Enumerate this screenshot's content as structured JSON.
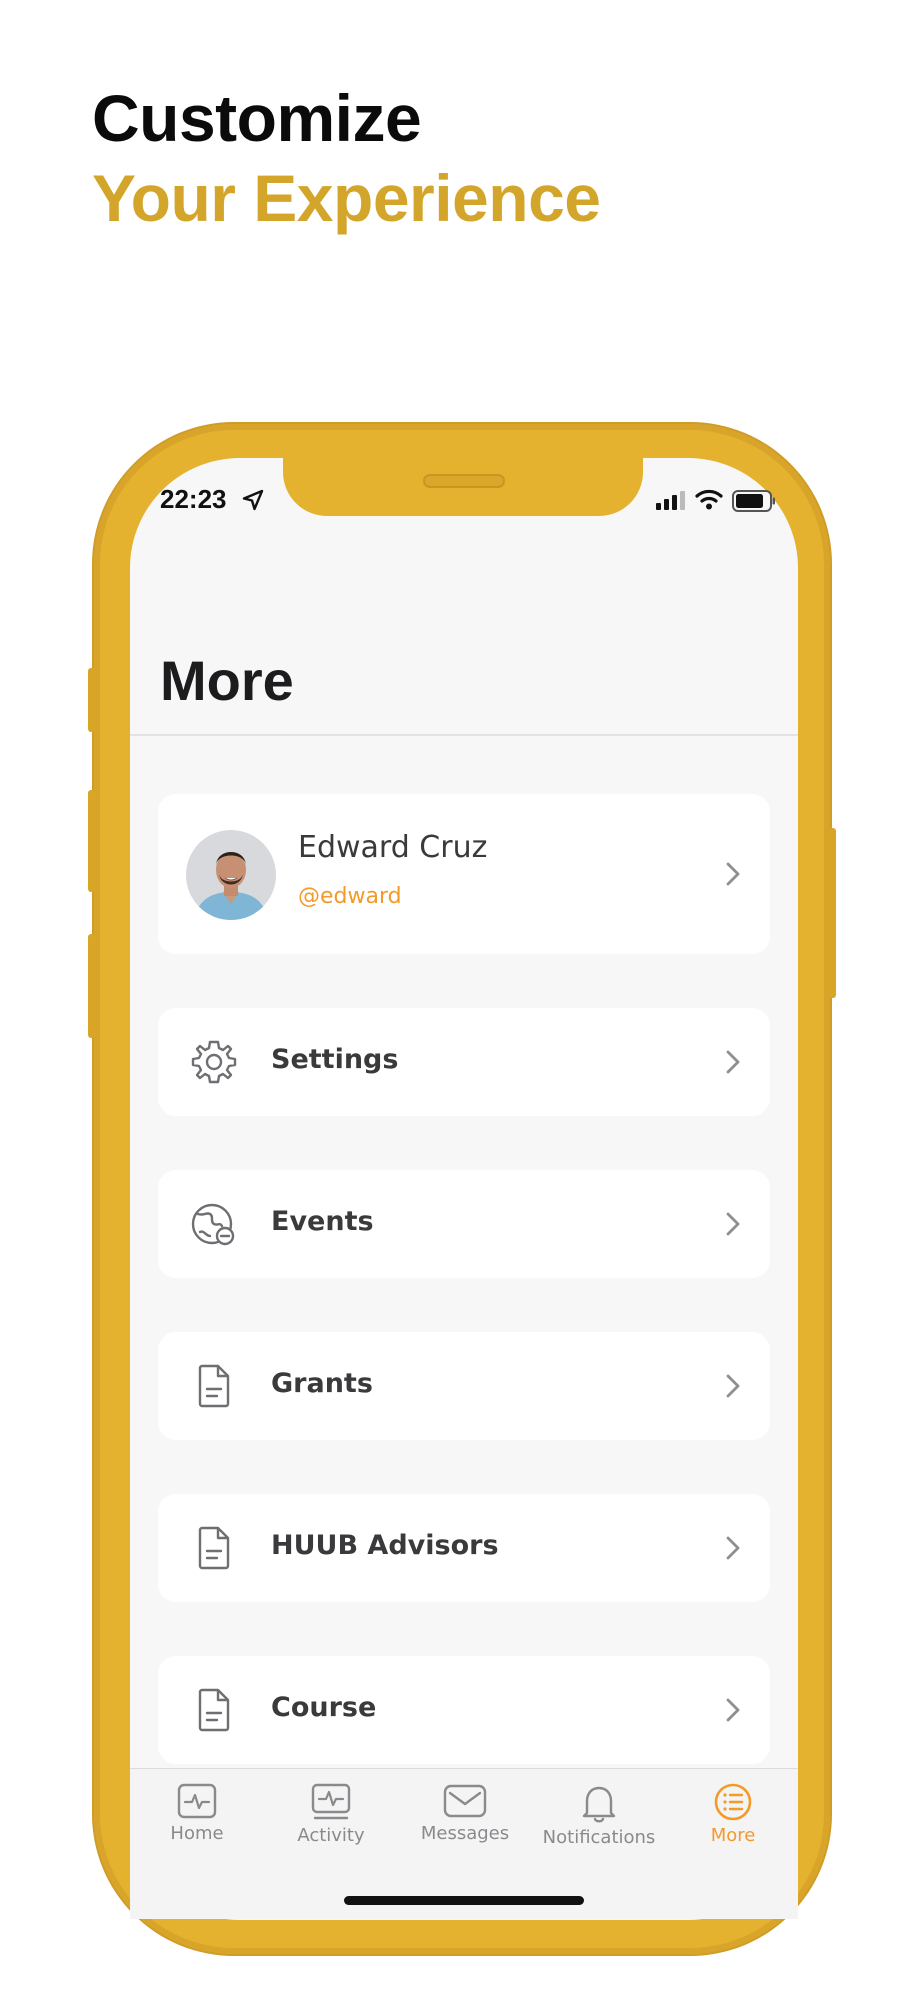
{
  "headline": {
    "line1": "Customize",
    "line2": "Your Experience"
  },
  "status_bar": {
    "time": "22:23"
  },
  "page_title": "More",
  "profile": {
    "name": "Edward Cruz",
    "handle": "@edward"
  },
  "menu_items": [
    {
      "label": "Settings",
      "icon": "gear-icon"
    },
    {
      "label": "Events",
      "icon": "globe-icon"
    },
    {
      "label": "Grants",
      "icon": "document-icon"
    },
    {
      "label": "HUUB Advisors",
      "icon": "document-icon"
    },
    {
      "label": "Course",
      "icon": "document-icon"
    }
  ],
  "tab_bar": [
    {
      "label": "Home",
      "icon": "pulse-icon",
      "active": false
    },
    {
      "label": "Activity",
      "icon": "activity-icon",
      "active": false
    },
    {
      "label": "Messages",
      "icon": "envelope-icon",
      "active": false
    },
    {
      "label": "Notifications",
      "icon": "bell-icon",
      "active": false
    },
    {
      "label": "More",
      "icon": "list-icon",
      "active": true
    }
  ],
  "colors": {
    "accent": "#f39a28",
    "brand_gold": "#d3a52a",
    "phone_frame": "#e5b22f",
    "text_dark": "#1c1c1e",
    "text_body": "#3a3a3c"
  }
}
